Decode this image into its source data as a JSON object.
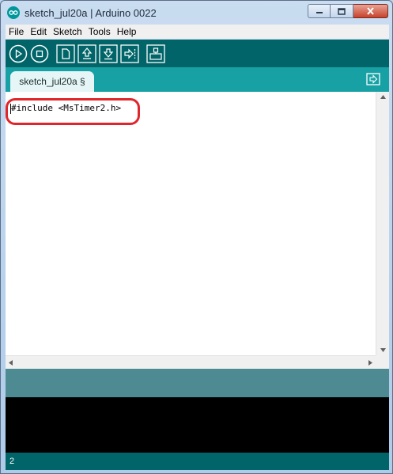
{
  "window": {
    "title": "sketch_jul20a | Arduino 0022",
    "app_icon": "arduino-logo-icon"
  },
  "menu": {
    "items": [
      {
        "label": "File"
      },
      {
        "label": "Edit"
      },
      {
        "label": "Sketch"
      },
      {
        "label": "Tools"
      },
      {
        "label": "Help"
      }
    ]
  },
  "toolbar": {
    "buttons": [
      "verify-icon",
      "stop-icon",
      "new-icon",
      "open-icon",
      "save-icon",
      "upload-icon",
      "serial-monitor-icon"
    ]
  },
  "tabs": {
    "active_label": "sketch_jul20a §"
  },
  "editor": {
    "code": "#include <MsTimer2.h>"
  },
  "status": {
    "line_number": "2"
  },
  "colors": {
    "toolbar": "#006468",
    "tabbar": "#17a1a5",
    "status": "#4d8a92",
    "highlight": "#e0262b"
  }
}
